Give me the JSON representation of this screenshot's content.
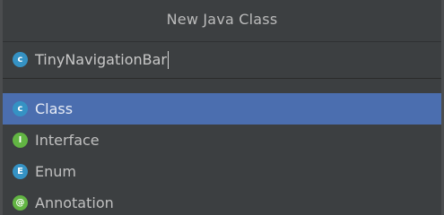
{
  "dialog": {
    "title": "New Java Class"
  },
  "name_field": {
    "icon": "class-icon",
    "icon_letter": "c",
    "value": "TinyNavigationBar"
  },
  "kinds": [
    {
      "label": "Class",
      "icon": "class-icon",
      "icon_letter": "c",
      "selected": true
    },
    {
      "label": "Interface",
      "icon": "interface-icon",
      "icon_letter": "I",
      "selected": false
    },
    {
      "label": "Enum",
      "icon": "enum-icon",
      "icon_letter": "E",
      "selected": false
    },
    {
      "label": "Annotation",
      "icon": "annotation-icon",
      "icon_letter": "@",
      "selected": false
    }
  ],
  "colors": {
    "background": "#3c3f41",
    "selection": "#4b6eaf",
    "class_icon": "#3592c4",
    "interface_icon": "#62b543"
  }
}
